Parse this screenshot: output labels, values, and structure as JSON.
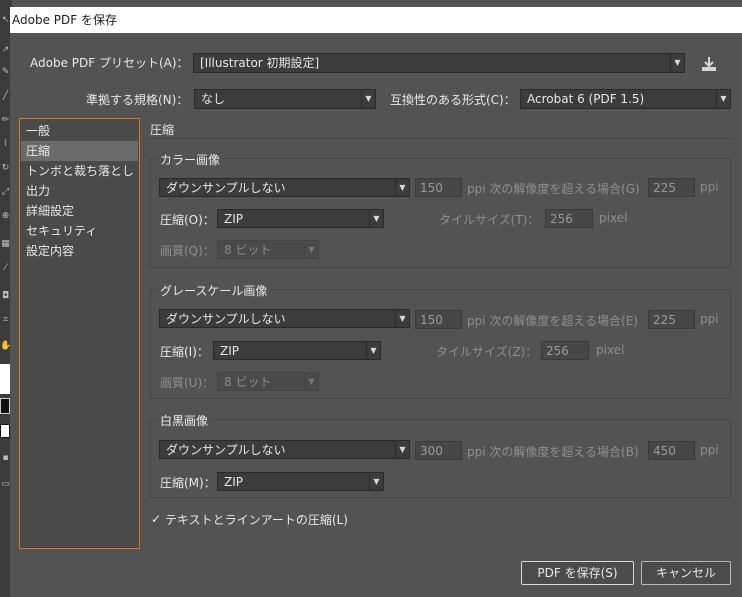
{
  "window": {
    "title": "Adobe PDF を保存"
  },
  "preset": {
    "label": "Adobe PDF プリセット(A)：",
    "value": "[Illustrator 初期設定]"
  },
  "standard": {
    "label": "準拠する規格(N)：",
    "value": "なし"
  },
  "compat": {
    "label": "互換性のある形式(C)：",
    "value": "Acrobat 6 (PDF 1.5)"
  },
  "sidebar": {
    "items": [
      {
        "label": "一般"
      },
      {
        "label": "圧縮"
      },
      {
        "label": "トンボと裁ち落とし"
      },
      {
        "label": "出力"
      },
      {
        "label": "詳細設定"
      },
      {
        "label": "セキュリティ"
      },
      {
        "label": "設定内容"
      }
    ],
    "selected_index": 1
  },
  "section_title": "圧縮",
  "color": {
    "title": "カラー画像",
    "downsample": "ダウンサンプルしない",
    "ppi_value": "150",
    "ppi_label": "ppi 次の解像度を超える場合(G)",
    "threshold_value": "225",
    "threshold_unit": "ppi",
    "compression_label": "圧縮(O)：",
    "compression_value": "ZIP",
    "tile_label": "タイルサイズ(T)：",
    "tile_value": "256",
    "tile_unit": "pixel",
    "quality_label": "画質(Q)：",
    "quality_value": "8 ビット"
  },
  "gray": {
    "title": "グレースケール画像",
    "downsample": "ダウンサンプルしない",
    "ppi_value": "150",
    "ppi_label": "ppi 次の解像度を超える場合(E)",
    "threshold_value": "225",
    "threshold_unit": "ppi",
    "compression_label": "圧縮(I)：",
    "compression_value": "ZIP",
    "tile_label": "タイルサイズ(Z)：",
    "tile_value": "256",
    "tile_unit": "pixel",
    "quality_label": "画質(U)：",
    "quality_value": "8 ビット"
  },
  "mono": {
    "title": "白黒画像",
    "downsample": "ダウンサンプルしない",
    "ppi_value": "300",
    "ppi_label": "ppi 次の解像度を超える場合(B)",
    "threshold_value": "450",
    "threshold_unit": "ppi",
    "compression_label": "圧縮(M)：",
    "compression_value": "ZIP"
  },
  "compress_text": {
    "label": "テキストとラインアートの圧縮(L)",
    "checked": true
  },
  "buttons": {
    "save": "PDF を保存(S)",
    "cancel": "キャンセル"
  }
}
